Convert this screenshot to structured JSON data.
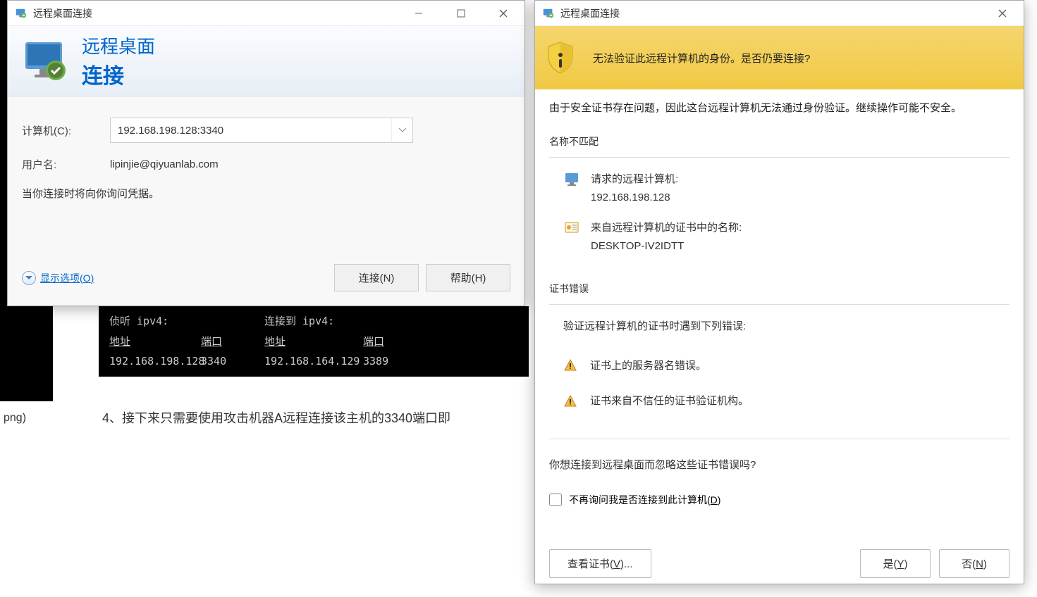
{
  "bg": {
    "filename": "png)",
    "terminal": {
      "col1h": "侦听 ipv4:",
      "col2h": "连接到 ipv4:",
      "addr_label": "地址",
      "port_label": "端口",
      "addr1": "192.168.198.128",
      "port1": "3340",
      "addr2": "192.168.164.129",
      "port2": "3389"
    },
    "text_line": "4、接下来只需要使用攻击机器A远程连接该主机的3340端口即"
  },
  "window1": {
    "title": "远程桌面连接",
    "banner_line1": "远程桌面",
    "banner_line2": "连接",
    "computer_label": "计算机(C):",
    "computer_value": "192.168.198.128:3340",
    "username_label": "用户名:",
    "username_value": "lipinjie@qiyuanlab.com",
    "info_text": "当你连接时将向你询问凭据。",
    "options_label": "显示选项(O)",
    "connect_btn": "连接(N)",
    "help_btn": "帮助(H)"
  },
  "window2": {
    "title": "远程桌面连接",
    "warning_text": "无法验证此远程计算机的身份。是否仍要连接?",
    "explanation": "由于安全证书存在问题，因此这台远程计算机无法通过身份验证。继续操作可能不安全。",
    "name_mismatch_title": "名称不匹配",
    "requested_label": "请求的远程计算机:",
    "requested_value": "192.168.198.128",
    "cert_name_label": "来自远程计算机的证书中的名称:",
    "cert_name_value": "DESKTOP-IV2IDTT",
    "cert_errors_title": "证书错误",
    "cert_errors_desc": "验证远程计算机的证书时遇到下列错误:",
    "error1": "证书上的服务器名错误。",
    "error2": "证书来自不信任的证书验证机构。",
    "question": "你想连接到远程桌面而忽略这些证书错误吗?",
    "checkbox_label": "不再询问我是否连接到此计算机(D)",
    "view_cert_btn": "查看证书(V)...",
    "yes_btn": "是(Y)",
    "no_btn": "否(N)"
  }
}
